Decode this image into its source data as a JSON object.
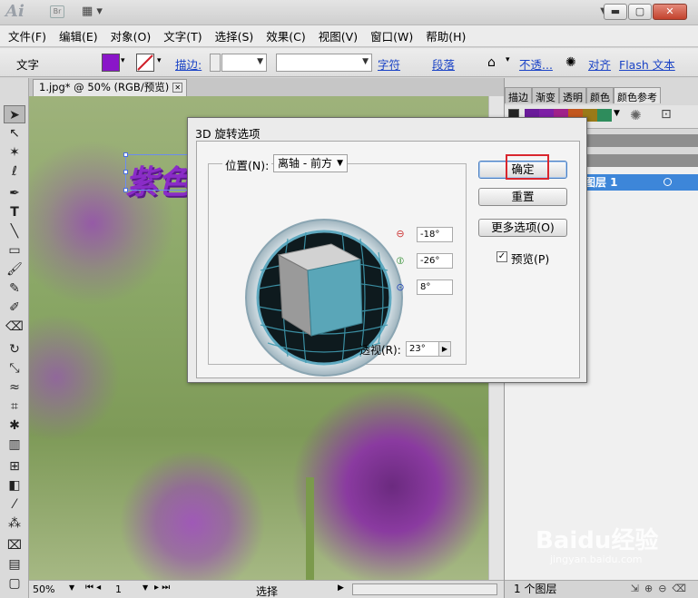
{
  "app": {
    "logo": "Ai",
    "bridge_badge": "Br",
    "window_buttons": {
      "min": "▬",
      "max": "▢",
      "close": "✕"
    }
  },
  "menu": [
    "文件(F)",
    "编辑(E)",
    "对象(O)",
    "文字(T)",
    "选择(S)",
    "效果(C)",
    "视图(V)",
    "窗口(W)",
    "帮助(H)"
  ],
  "control_bar": {
    "mode_label": "文字",
    "fill_color": "#8a16c9",
    "stroke_label": "描边:",
    "char_link": "字符",
    "para_link": "段落",
    "opacity_link": "不透...",
    "align_link": "对齐",
    "flash_link": "Flash 文本"
  },
  "document": {
    "tab_title": "1.jpg* @ 50% (RGB/预览)",
    "canvas_text": "紫色"
  },
  "status_bar": {
    "zoom": "50%",
    "page": "1",
    "tool": "选择"
  },
  "right_panel": {
    "tabs": [
      "描边",
      "渐变",
      "透明",
      "颜色",
      "颜色参考"
    ],
    "layer_name": "图层 1",
    "layer_count": "1 个图层",
    "swatches": [
      "#6a1b9a",
      "#7e1fa6",
      "#a0228a",
      "#c2571e",
      "#9a7a18",
      "#2e8c5c",
      "#1a9a8a"
    ]
  },
  "dialog": {
    "title": "3D 旋转选项",
    "position_label": "位置(N):",
    "position_value": "离轴 - 前方",
    "x_rotation": "-18°",
    "y_rotation": "-26°",
    "z_rotation": "8°",
    "perspective_label": "透视(R):",
    "perspective_value": "23°",
    "ok_label": "确定",
    "reset_label": "重置",
    "more_label": "更多选项(O)",
    "preview_label": "预览(P)",
    "preview_checked": true
  },
  "watermark": {
    "main": "Baidu经验",
    "sub": "jingyan.baidu.com"
  }
}
